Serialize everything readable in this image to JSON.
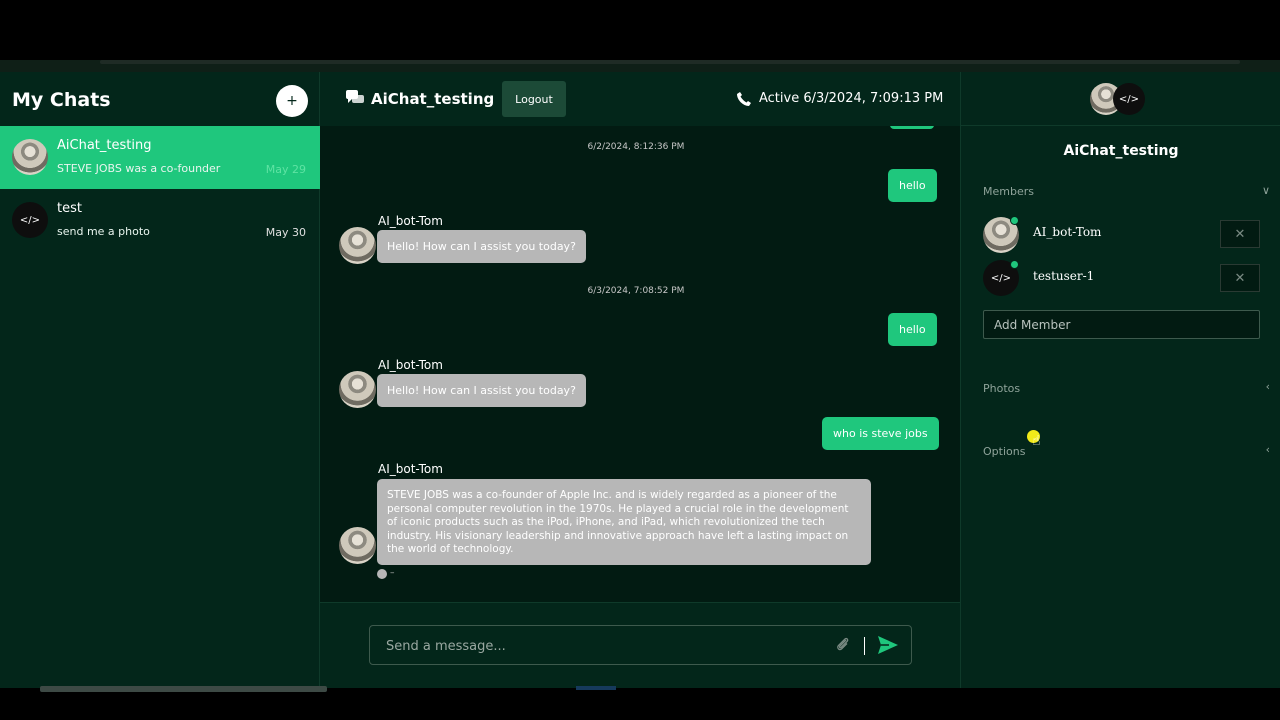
{
  "sidebar": {
    "title": "My Chats",
    "new_chat_symbol": "+",
    "chats": [
      {
        "name": "AiChat_testing",
        "preview": "STEVE JOBS was a co-founder",
        "date": "May 29",
        "avatar": "robot-avatar",
        "active": true
      },
      {
        "name": "test",
        "preview": "send me a photo",
        "date": "May 30",
        "avatar": "code-avatar",
        "active": false
      }
    ]
  },
  "header": {
    "chat_title": "AiChat_testing",
    "logout_label": "Logout",
    "status": "Active 6/3/2024, 7:09:13 PM"
  },
  "messages": {
    "timestamps": [
      "6/2/2024, 8:12:36 PM",
      "6/3/2024, 7:08:52 PM"
    ],
    "user": [
      "hello",
      "hello",
      "who is steve jobs"
    ],
    "bot_name": "AI_bot-Tom",
    "bot": [
      "Hello! How can I assist you today?",
      "Hello! How can I assist you today?",
      "STEVE JOBS was a co-founder of Apple Inc. and is widely regarded as a pioneer of the personal computer revolution in the 1970s. He played a crucial role in the development of iconic products such as the iPod, iPhone, and iPad, which revolutionized the tech industry. His visionary leadership and innovative approach have left a lasting impact on the world of technology."
    ],
    "read_marker": "–"
  },
  "composer": {
    "placeholder": "Send a message..."
  },
  "details": {
    "code_symbol": "</>",
    "group_title": "AiChat_testing",
    "members_label": "Members",
    "members": [
      {
        "name": "AI_bot-Tom",
        "online": true
      },
      {
        "name": "testuser-1",
        "online": true
      }
    ],
    "remove_symbol": "✕",
    "add_member_placeholder": "Add Member",
    "photos_label": "Photos",
    "options_label": "Options"
  },
  "colors": {
    "accent": "#1fc77d",
    "background": "#03261a",
    "chat_background": "#021b12",
    "bot_bubble": "#b7b7b7"
  }
}
